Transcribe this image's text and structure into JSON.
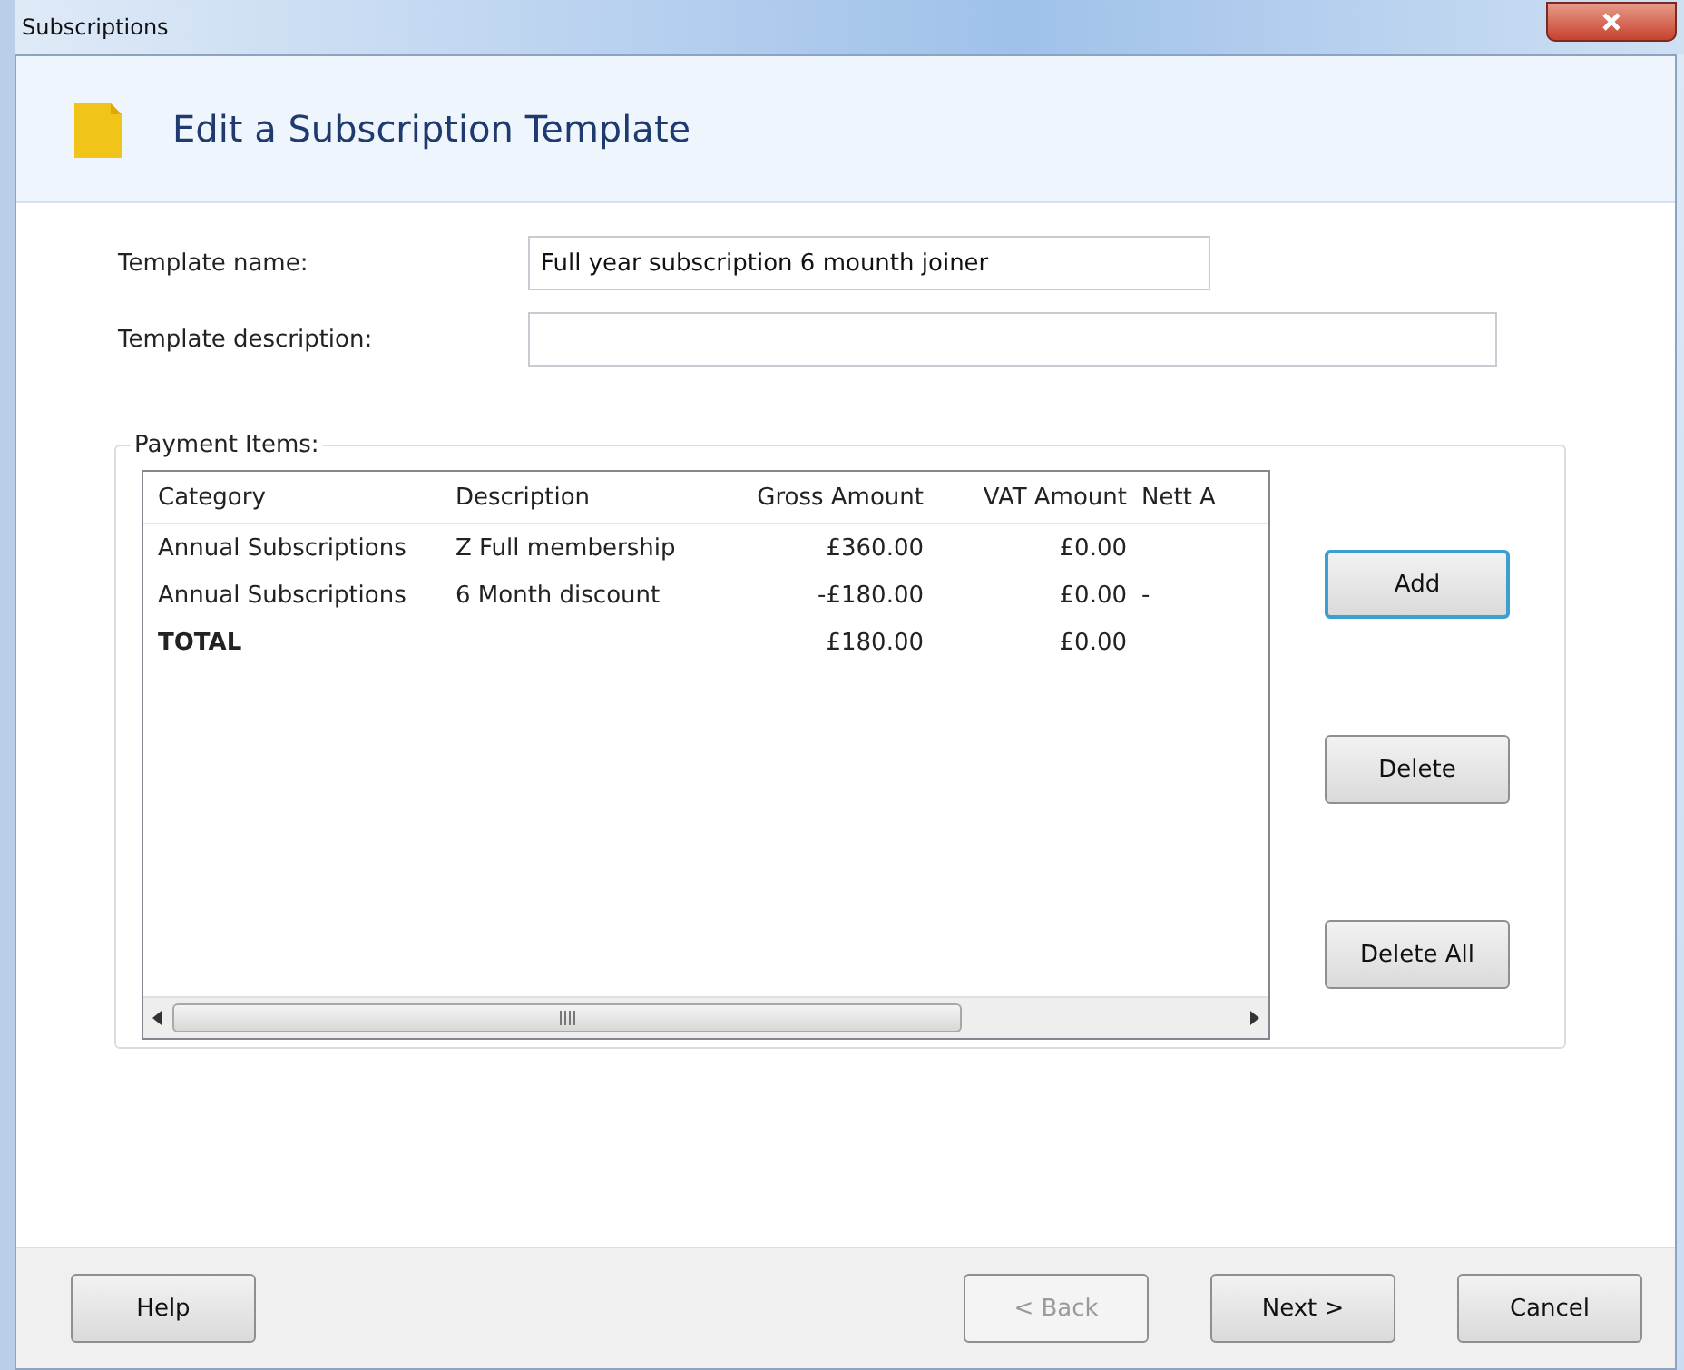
{
  "window": {
    "title": "Subscriptions"
  },
  "header": {
    "title": "Edit a Subscription Template"
  },
  "fields": [
    {
      "label": "Template name:",
      "value": "Full year subscription 6 mounth joiner",
      "kind": "short"
    },
    {
      "label": "Template description:",
      "kind": "long"
    }
  ],
  "payment_items": {
    "label": "Payment Items:",
    "columns": [
      "Category",
      "Description",
      "Gross Amount",
      "VAT Amount",
      "Nett A"
    ],
    "rows": [
      {
        "cells": [
          "Annual Subscriptions",
          "Z Full membership",
          "£360.00",
          "£0.00"
        ],
        "bold": false
      },
      {
        "cells": [
          "Annual Subscriptions",
          "6 Month discount",
          "-£180.00",
          "£0.00",
          "-"
        ],
        "bold": false
      },
      {
        "cells": [
          "TOTAL",
          null,
          "£180.00",
          "£0.00"
        ],
        "bold": true
      }
    ],
    "buttons": [
      {
        "label": "Add",
        "default": true
      },
      {
        "label": "Delete",
        "default": false
      },
      {
        "label": "Delete All",
        "default": false
      }
    ]
  },
  "footer_buttons": [
    {
      "label": "Help",
      "disabled": false,
      "kind": "left"
    },
    {
      "label": "< Back",
      "disabled": true,
      "kind": "right"
    },
    {
      "label": "Next >",
      "disabled": false,
      "kind": "right"
    },
    {
      "label": "Cancel",
      "disabled": false,
      "kind": "right"
    }
  ]
}
